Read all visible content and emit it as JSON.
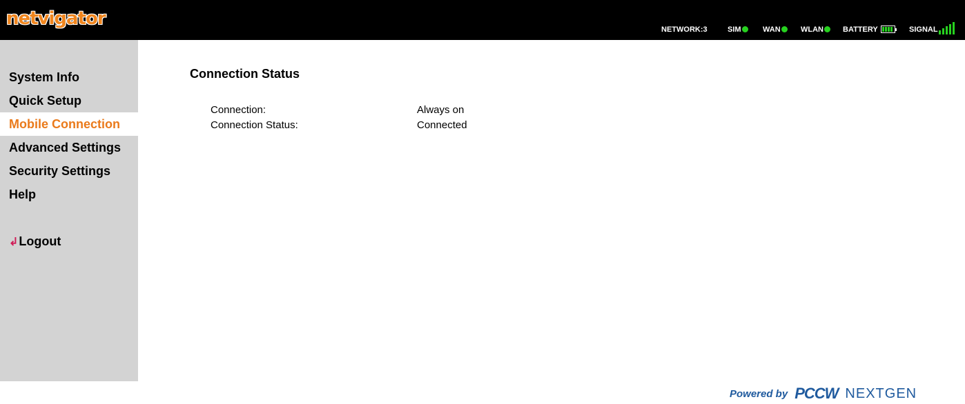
{
  "header": {
    "logo_text": "netvigator",
    "status": {
      "network_label": "NETWORK:3",
      "sim_label": "SIM",
      "wan_label": "WAN",
      "wlan_label": "WLAN",
      "battery_label": "BATTERY",
      "signal_label": "SIGNAL",
      "led_color": "#27d11f",
      "battery_level": 1.0,
      "signal_bars": 5
    }
  },
  "sidebar": {
    "items": [
      {
        "label": "System Info"
      },
      {
        "label": "Quick Setup"
      },
      {
        "label": "Mobile Connection"
      },
      {
        "label": "Advanced Settings"
      },
      {
        "label": "Security Settings"
      },
      {
        "label": "Help"
      }
    ],
    "active_item": "Mobile Connection",
    "logout_label": "Logout",
    "accent_color": "#ea7a1b"
  },
  "main": {
    "title": "Connection Status",
    "rows": [
      {
        "label": "Connection:",
        "value": "Always on"
      },
      {
        "label": "Connection Status:",
        "value": "Connected"
      }
    ]
  },
  "footer": {
    "powered_by": "Powered by",
    "brand": "PCCW",
    "product": "NEXTGEN"
  }
}
